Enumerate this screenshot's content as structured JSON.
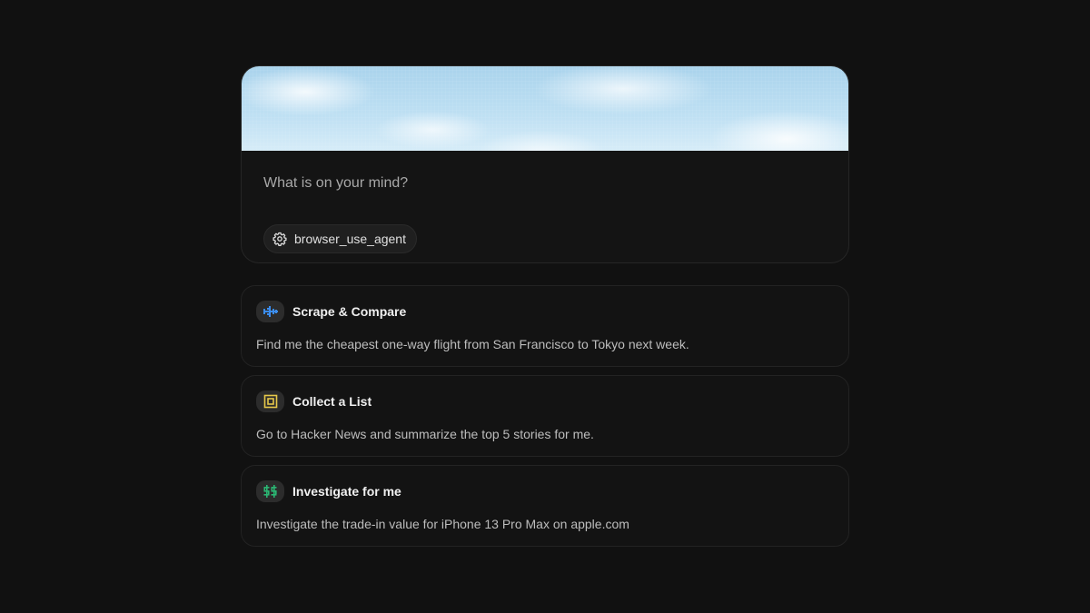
{
  "composer": {
    "placeholder": "What is on your mind?",
    "agent_chip": {
      "icon": "gear-icon",
      "label": "browser_use_agent"
    }
  },
  "suggestions": [
    {
      "icon": "airplane-icon",
      "icon_color": "#3b8df0",
      "title": "Scrape & Compare",
      "description": "Find me the cheapest one-way flight from San Francisco to Tokyo next week."
    },
    {
      "icon": "list-frame-icon",
      "icon_color": "#e6c84a",
      "title": "Collect a List",
      "description": "Go to Hacker News and summarize the top 5 stories for me."
    },
    {
      "icon": "dollar-icon",
      "icon_color": "#2bb673",
      "title": "Investigate for me",
      "description": "Investigate the trade-in value for iPhone 13 Pro Max on apple.com"
    }
  ],
  "colors": {
    "background": "#111111",
    "card_border": "#232323"
  }
}
